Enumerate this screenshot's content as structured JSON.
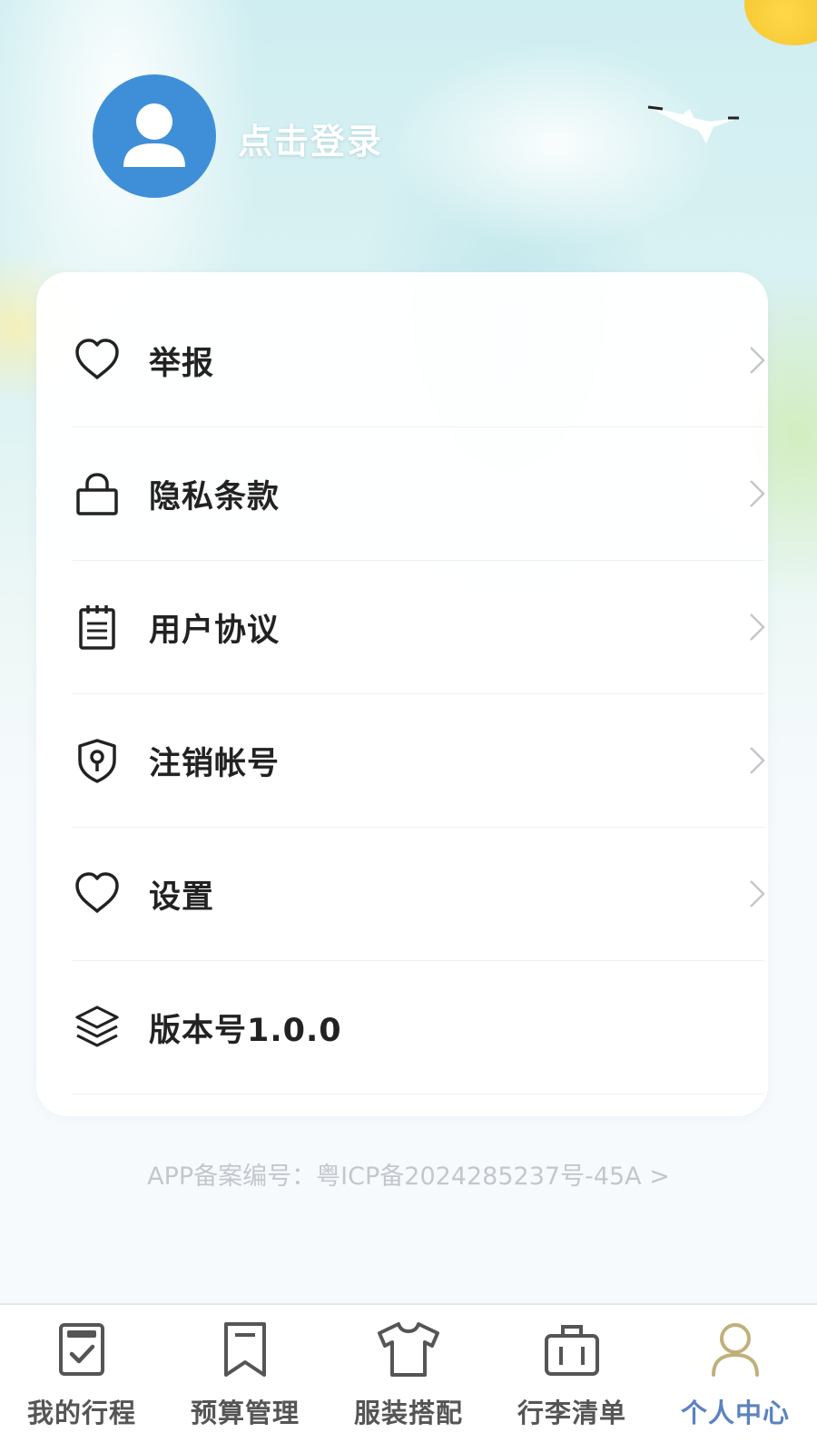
{
  "header": {
    "login_text": "点击登录"
  },
  "menu": {
    "items": [
      {
        "label": "举报",
        "icon": "heart-icon",
        "chevron": true
      },
      {
        "label": "隐私条款",
        "icon": "lock-icon",
        "chevron": true
      },
      {
        "label": "用户协议",
        "icon": "notepad-icon",
        "chevron": true
      },
      {
        "label": "注销帐号",
        "icon": "shield-keyhole-icon",
        "chevron": true
      },
      {
        "label": "设置",
        "icon": "heart-icon",
        "chevron": true
      },
      {
        "label": "版本号1.0.0",
        "icon": "layers-icon",
        "chevron": false
      }
    ]
  },
  "footer": {
    "icp_text": "APP备案编号：粤ICP备2024285237号-45A >"
  },
  "tabbar": {
    "tabs": [
      {
        "label": "我的行程",
        "icon": "checklist-icon",
        "active": false
      },
      {
        "label": "预算管理",
        "icon": "bookmark-icon",
        "active": false
      },
      {
        "label": "服装搭配",
        "icon": "tshirt-icon",
        "active": false
      },
      {
        "label": "行李清单",
        "icon": "suitcase-icon",
        "active": false
      },
      {
        "label": "个人中心",
        "icon": "person-icon",
        "active": true
      }
    ]
  },
  "colors": {
    "avatar_bg": "#3f8fd8",
    "active_tab": "#5b83c0",
    "inactive_tab": "#555555",
    "icp_text": "#c3c7cc"
  }
}
